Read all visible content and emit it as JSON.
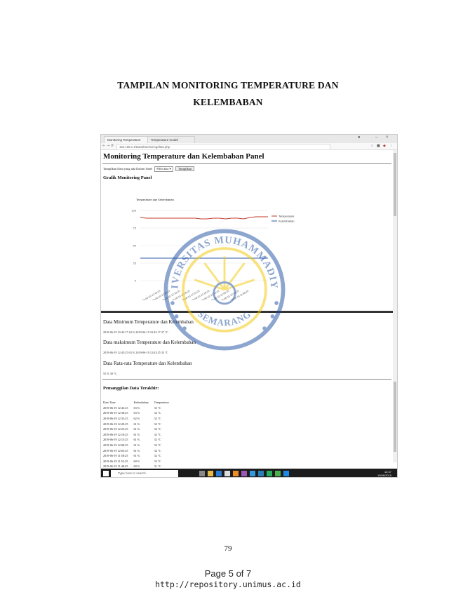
{
  "doc": {
    "title_line1": "TAMPILAN MONITORING TEMPERATURE DAN",
    "title_line2": "KELEMBABAN",
    "page_number": "79",
    "footer_page": "Page 5 of 7",
    "footer_url": "http://repository.unimus.ac.id"
  },
  "watermark": {
    "top_text": "UNIVERSITAS MUHAMMADIYAH",
    "bottom_text": "SEMARANG",
    "color": "#f3c700",
    "ring_color": "#1d4fa0"
  },
  "browser": {
    "tab1": "Monitoring Temperature",
    "tab2": "Temperature model",
    "url": "192.168.1.1/Data/Monitoring/data.php",
    "page": {
      "heading": "Monitoring Temperature dan Kelembaban Panel",
      "select_label": "Tampilkan Data yang ada Dalam Tabel",
      "select_value": "Pilih data",
      "button_label": "Tampilkan",
      "chart_heading": "Grafik Monitoring Panel",
      "min_heading": "Data Minimum Temperature dan Kelembaban",
      "min_value": "2019-06-19 10:43:17 44 % 2019-06-19 10:43:17 27 °C",
      "max_heading": "Data maksimum Temperature dan Kelembaban",
      "max_value": "2019-06-19 12:43:25 63 % 2019-06-19 12:43:25 33 °C",
      "avg_heading": "Data Rata-rata Temperature dan Kelembaban",
      "avg_value": "55 % 30 °C",
      "log_heading": "Pemanggilan Data Terakhir:",
      "log_columns": [
        "Date Time",
        "Kelembaban",
        "Temperature"
      ],
      "log_rows": [
        [
          "2019-06-19 12:43:25",
          "63 %",
          "33 °C"
        ],
        [
          "2019-06-19 12:38:25",
          "63 %",
          "32 °C"
        ],
        [
          "2019-06-19 12:33:25",
          "62 %",
          "32 °C"
        ],
        [
          "2019-06-19 12:28:25",
          "61 %",
          "32 °C"
        ],
        [
          "2019-06-19 12:23:25",
          "61 %",
          "32 °C"
        ],
        [
          "2019-06-19 12:18:25",
          "61 %",
          "32 °C"
        ],
        [
          "2019-06-19 12:13:25",
          "61 %",
          "32 °C"
        ],
        [
          "2019-06-19 12:08:25",
          "61 %",
          "32 °C"
        ],
        [
          "2019-06-19 12:03:25",
          "61 %",
          "32 °C"
        ],
        [
          "2019-06-19 11:58:25",
          "61 %",
          "32 °C"
        ],
        [
          "2019-06-19 11:53:25",
          "60 %",
          "32 °C"
        ],
        [
          "2019-06-19 11:48:25",
          "60 %",
          "31 °C"
        ],
        [
          "2019-06-19 11:43:25",
          "60 %",
          "31 °C"
        ],
        [
          "2019-06-19 11:38:25",
          "60 %",
          "31 °C"
        ]
      ]
    },
    "taskbar_search": "Type here to search",
    "clock_time": "12:47",
    "clock_date": "19/06/2019"
  },
  "chart_data": {
    "type": "line",
    "title": "Temperature dan Kelembaban",
    "ylim": [
      0,
      100
    ],
    "yticks": [
      "100",
      "75",
      "50",
      "25",
      "0"
    ],
    "series": [
      {
        "name": "Temperature",
        "color": "#c0392b",
        "values": [
          90,
          89,
          89,
          89,
          89,
          89,
          89,
          89,
          89,
          89,
          88,
          88,
          89,
          89,
          88,
          89,
          89,
          88,
          90,
          91,
          91,
          91
        ]
      },
      {
        "name": "Kelembaban",
        "color": "#2e5aa8",
        "values": [
          32,
          32,
          32,
          32,
          32,
          32,
          32,
          32,
          32,
          32,
          32,
          32,
          32,
          32,
          32,
          32,
          32,
          32,
          32,
          32,
          32,
          32
        ]
      }
    ]
  }
}
